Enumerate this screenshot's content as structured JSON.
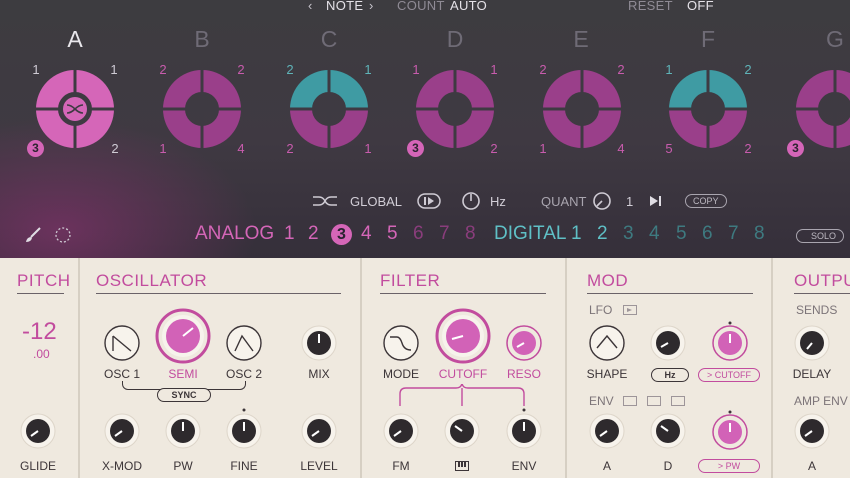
{
  "header": {
    "prev": "‹",
    "note": "NOTE",
    "next": "›",
    "count_label": "COUNT",
    "count_value": "AUTO",
    "reset_label": "RESET",
    "reset_value": "OFF"
  },
  "columns": [
    {
      "letter": "A",
      "tl": "1",
      "tr": "1",
      "bl": "3",
      "br": "2",
      "active": true
    },
    {
      "letter": "B",
      "tl": "2",
      "tr": "2",
      "bl": "1",
      "br": "4"
    },
    {
      "letter": "C",
      "tl": "2",
      "tr": "1",
      "bl": "2",
      "br": "1"
    },
    {
      "letter": "D",
      "tl": "1",
      "tr": "1",
      "bl": "3",
      "br": "2"
    },
    {
      "letter": "E",
      "tl": "2",
      "tr": "2",
      "bl": "1",
      "br": "4"
    },
    {
      "letter": "F",
      "tl": "1",
      "tr": "2",
      "bl": "5",
      "br": "2"
    },
    {
      "letter": "G",
      "tl": "",
      "tr": "",
      "bl": "3",
      "br": ""
    }
  ],
  "controls": {
    "global": "GLOBAL",
    "hz": "Hz",
    "quant": "QUANT",
    "quant_value": "1",
    "copy": "COPY"
  },
  "sequencer": {
    "analog_label": "ANALOG",
    "analog_steps": [
      "1",
      "2",
      "3",
      "4",
      "5",
      "6",
      "7",
      "8"
    ],
    "digital_label": "DIGITAL",
    "digital_steps": [
      "1",
      "2",
      "3",
      "4",
      "5",
      "6",
      "7",
      "8"
    ],
    "solo": "SOLO"
  },
  "pitch": {
    "title": "PITCH",
    "value": "-12",
    "fine": ".00",
    "glide": "GLIDE"
  },
  "oscillator": {
    "title": "OSCILLATOR",
    "osc1": "OSC 1",
    "semi": "SEMI",
    "osc2": "OSC 2",
    "mix": "MIX",
    "sync": "SYNC",
    "xmod": "X-MOD",
    "pw": "PW",
    "fine": "FINE",
    "level": "LEVEL"
  },
  "filter": {
    "title": "FILTER",
    "mode": "MODE",
    "cutoff": "CUTOFF",
    "reso": "RESO",
    "fm": "FM",
    "env": "ENV"
  },
  "mod": {
    "title": "MOD",
    "lfo": "LFO",
    "shape": "SHAPE",
    "hz": "Hz",
    "cutoff_tag": "> CUTOFF",
    "env": "ENV",
    "a": "A",
    "d": "D",
    "pw_tag": "> PW"
  },
  "output": {
    "title": "OUTPU",
    "sends": "SENDS",
    "delay": "DELAY",
    "amp_env": "AMP ENV",
    "a": "A"
  },
  "colors": {
    "magenta": "#c85cad",
    "teal": "#4aa6ad",
    "panel": "#efe9df"
  }
}
